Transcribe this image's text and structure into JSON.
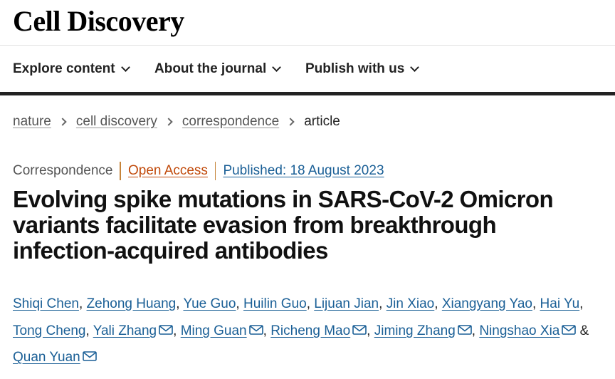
{
  "header": {
    "brand": "Cell Discovery"
  },
  "nav": {
    "items": [
      {
        "label": "Explore content"
      },
      {
        "label": "About the journal"
      },
      {
        "label": "Publish with us"
      }
    ]
  },
  "breadcrumb": {
    "items": [
      "nature",
      "cell discovery",
      "correspondence"
    ],
    "current": "article"
  },
  "article": {
    "type": "Correspondence",
    "access": "Open Access",
    "published": "Published: 18 August 2023",
    "title_lines": [
      "Evolving spike mutations in SARS-CoV-2 Omicron",
      "variants facilitate evasion from breakthrough",
      "infection-acquired antibodies"
    ]
  },
  "authors": {
    "names": [
      "Shiqi Chen",
      "Zehong Huang",
      "Yue Guo",
      "Huilin Guo",
      "Lijuan Jian",
      "Jin Xiao",
      "Xiangyang Yao",
      "Hai Yu",
      "Tong Cheng",
      "Yali Zhang",
      "Ming Guan",
      "Richeng Mao",
      "Jiming Zhang",
      "Ningshao Xia",
      "Quan Yuan"
    ],
    "ampersand": "&",
    "separator": ","
  },
  "colors": {
    "link": "#1a5f96",
    "open_access": "#c14a0b",
    "divider": "#c6843a"
  }
}
